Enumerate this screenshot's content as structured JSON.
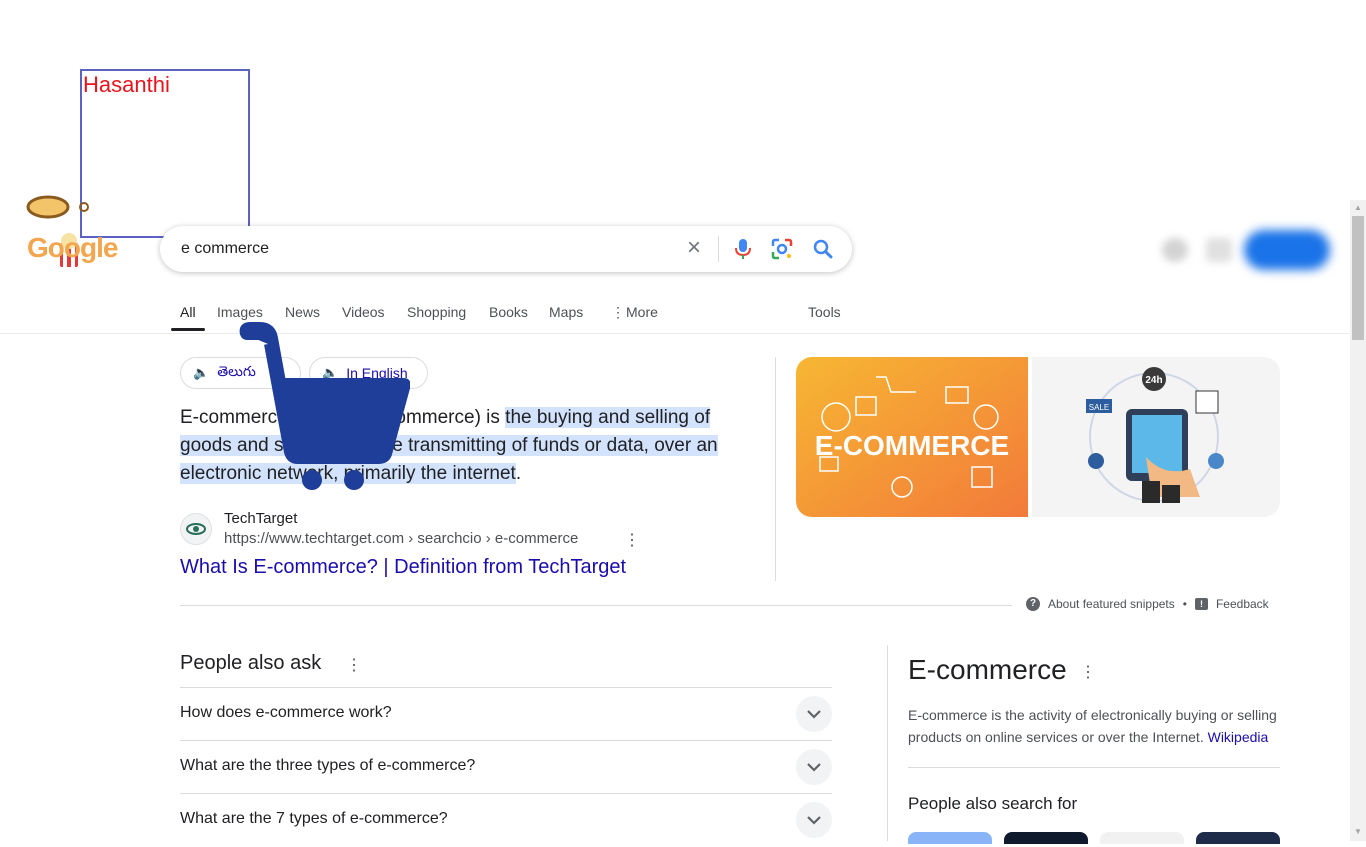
{
  "annotation": {
    "label": "Hasanthi"
  },
  "logo": {
    "text": "Google"
  },
  "search": {
    "query": "e commerce"
  },
  "tabs": [
    {
      "label": "All",
      "active": true
    },
    {
      "label": "Images"
    },
    {
      "label": "News"
    },
    {
      "label": "Videos"
    },
    {
      "label": "Shopping"
    },
    {
      "label": "Books"
    },
    {
      "label": "Maps"
    },
    {
      "label": "More"
    }
  ],
  "tools_label": "Tools",
  "chips": {
    "telugu": "తెలుగు",
    "english": "In English"
  },
  "snippet": {
    "pre": "E-commerce (electronic commerce) is ",
    "highlight1": "the buying and selling of goods and services, or the transmitting of funds or data, over an electronic network, primarily the ",
    "highlight2": "internet",
    "post": "."
  },
  "image_texts": {
    "left": "E-COMMERCE",
    "right_badge": "24h",
    "right_sale": "SALE"
  },
  "source": {
    "name": "TechTarget",
    "url": "https://www.techtarget.com › searchcio › e-commerce",
    "title": "What Is E-commerce? | Definition from TechTarget"
  },
  "snippet_footer": {
    "about": "About featured snippets",
    "dot": "•",
    "feedback": "Feedback"
  },
  "people_also_ask": {
    "title": "People also ask",
    "questions": [
      "How does e-commerce work?",
      "What are the three types of e-commerce?",
      "What are the 7 types of e-commerce?"
    ]
  },
  "knowledge_panel": {
    "title": "E-commerce",
    "description": "E-commerce is the activity of electronically buying or selling products on online services or over the Internet. ",
    "source_link": "Wikipedia",
    "people_also_search_for": "People also search for"
  },
  "colors": {
    "accent": "#1a73e8",
    "link": "#1a0dab",
    "highlight": "#d3e3fd",
    "cart": "#1f3e99",
    "annotation": "#e8141d"
  }
}
